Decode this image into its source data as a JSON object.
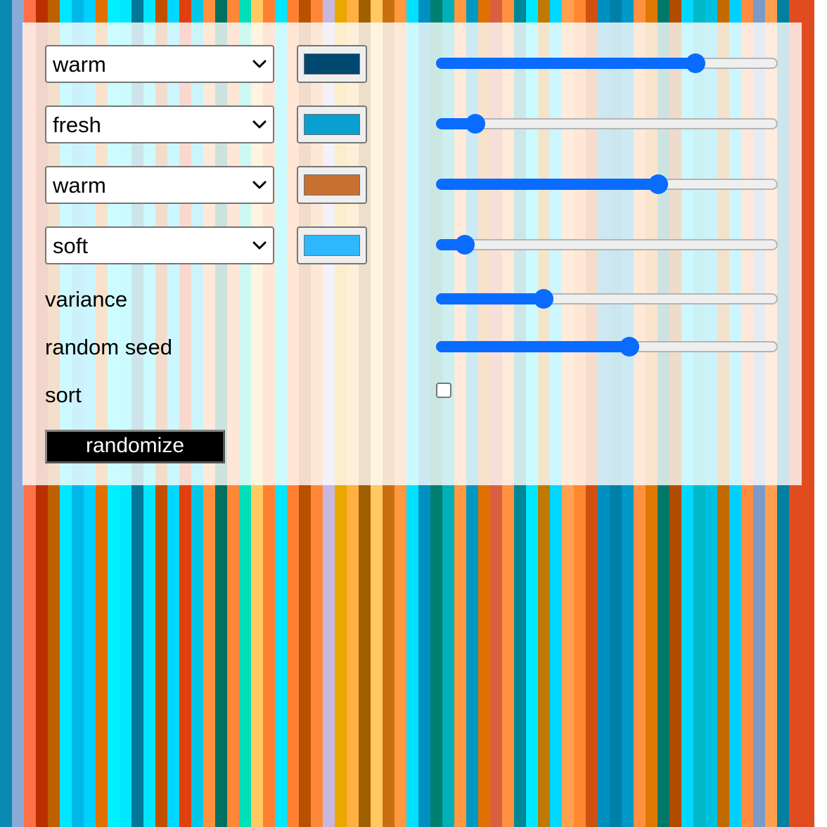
{
  "background": {
    "stripes": [
      {
        "color": "#0a8ab0",
        "w": 17
      },
      {
        "color": "#8aaad8",
        "w": 17
      },
      {
        "color": "#ff7048",
        "w": 17
      },
      {
        "color": "#b83000",
        "w": 17
      },
      {
        "color": "#c06000",
        "w": 17
      },
      {
        "color": "#00e6ff",
        "w": 17
      },
      {
        "color": "#00b8e8",
        "w": 17
      },
      {
        "color": "#00d0ff",
        "w": 17
      },
      {
        "color": "#e07000",
        "w": 17
      },
      {
        "color": "#00f0ff",
        "w": 17
      },
      {
        "color": "#00e8ff",
        "w": 17
      },
      {
        "color": "#007898",
        "w": 17
      },
      {
        "color": "#00e6ff",
        "w": 17
      },
      {
        "color": "#c05000",
        "w": 17
      },
      {
        "color": "#00d8ff",
        "w": 17
      },
      {
        "color": "#e04010",
        "w": 17
      },
      {
        "color": "#00c8e8",
        "w": 17
      },
      {
        "color": "#ff9040",
        "w": 17
      },
      {
        "color": "#007060",
        "w": 17
      },
      {
        "color": "#ff8838",
        "w": 17
      },
      {
        "color": "#00e0b8",
        "w": 17
      },
      {
        "color": "#ffc860",
        "w": 17
      },
      {
        "color": "#ff8030",
        "w": 17
      },
      {
        "color": "#00e8ff",
        "w": 17
      },
      {
        "color": "#ff8030",
        "w": 17
      },
      {
        "color": "#b85000",
        "w": 17
      },
      {
        "color": "#ff8838",
        "w": 17
      },
      {
        "color": "#c8b8e0",
        "w": 17
      },
      {
        "color": "#e8a800",
        "w": 17
      },
      {
        "color": "#ffb040",
        "w": 17
      },
      {
        "color": "#a06000",
        "w": 17
      },
      {
        "color": "#ffc860",
        "w": 17
      },
      {
        "color": "#c87010",
        "w": 17
      },
      {
        "color": "#ff9840",
        "w": 17
      },
      {
        "color": "#00e0ff",
        "w": 17
      },
      {
        "color": "#0090c0",
        "w": 17
      },
      {
        "color": "#008070",
        "w": 17
      },
      {
        "color": "#00b0b8",
        "w": 17
      },
      {
        "color": "#ff9840",
        "w": 17
      },
      {
        "color": "#0098c0",
        "w": 17
      },
      {
        "color": "#e07000",
        "w": 17
      },
      {
        "color": "#d86040",
        "w": 17
      },
      {
        "color": "#ff9040",
        "w": 17
      },
      {
        "color": "#008898",
        "w": 17
      },
      {
        "color": "#00e8ff",
        "w": 17
      },
      {
        "color": "#c07800",
        "w": 17
      },
      {
        "color": "#00d8ff",
        "w": 17
      },
      {
        "color": "#ffa050",
        "w": 17
      },
      {
        "color": "#ff8830",
        "w": 17
      },
      {
        "color": "#d05010",
        "w": 17
      },
      {
        "color": "#0090c0",
        "w": 17
      },
      {
        "color": "#0080a8",
        "w": 17
      },
      {
        "color": "#0098c8",
        "w": 17
      },
      {
        "color": "#ff9040",
        "w": 17
      },
      {
        "color": "#e07800",
        "w": 17
      },
      {
        "color": "#007a68",
        "w": 17
      },
      {
        "color": "#b04c00",
        "w": 17
      },
      {
        "color": "#00d8ff",
        "w": 17
      },
      {
        "color": "#00b8c8",
        "w": 17
      },
      {
        "color": "#00c0e0",
        "w": 17
      },
      {
        "color": "#c06a00",
        "w": 17
      },
      {
        "color": "#00d0ff",
        "w": 17
      },
      {
        "color": "#ff8c40",
        "w": 17
      },
      {
        "color": "#7a9ac8",
        "w": 17
      },
      {
        "color": "#ffa050",
        "w": 17
      },
      {
        "color": "#0080a0",
        "w": 17
      },
      {
        "color": "#e04c20",
        "w": 36
      }
    ]
  },
  "controls": {
    "rows": [
      {
        "palette": "warm",
        "swatch_color": "#004870",
        "slider_fraction": 0.76
      },
      {
        "palette": "fresh",
        "swatch_color": "#08a0d0",
        "slider_fraction": 0.115
      },
      {
        "palette": "warm",
        "swatch_color": "#c87030",
        "slider_fraction": 0.65
      },
      {
        "palette": "soft",
        "swatch_color": "#30b8ff",
        "slider_fraction": 0.085
      }
    ],
    "variance": {
      "label": "variance",
      "slider_fraction": 0.315
    },
    "random_seed": {
      "label": "random seed",
      "slider_fraction": 0.565
    },
    "sort": {
      "label": "sort",
      "checked": false
    },
    "randomize_label": "randomize"
  }
}
